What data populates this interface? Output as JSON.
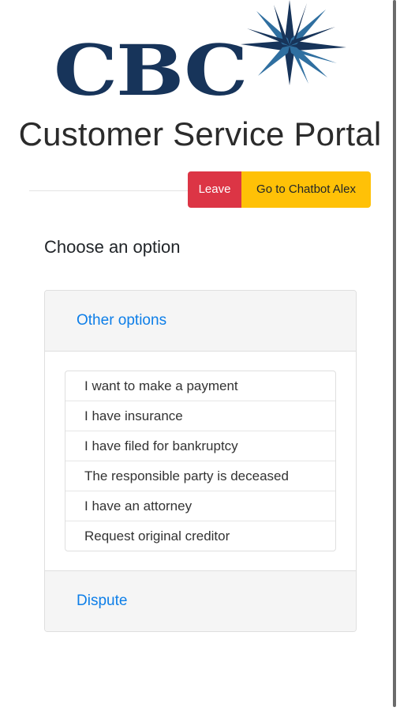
{
  "logo": {
    "text": "CBC",
    "brand_color": "#17345a",
    "accent_color": "#2f6fa0",
    "icon": "compass-star-icon"
  },
  "portal_title": "Customer Service Portal",
  "actions": {
    "leave_label": "Leave",
    "leave_color": "#dc3545",
    "chatbot_label": "Go to Chatbot Alex",
    "chatbot_color": "#ffc107"
  },
  "main": {
    "heading": "Choose an option",
    "accordion": {
      "other_options_label": "Other options",
      "options": [
        "I want to make a payment",
        "I have insurance",
        "I have filed for bankruptcy",
        "The responsible party is deceased",
        "I have an attorney",
        "Request original creditor"
      ],
      "dispute_label": "Dispute"
    },
    "link_color": "#0d7ee8"
  }
}
